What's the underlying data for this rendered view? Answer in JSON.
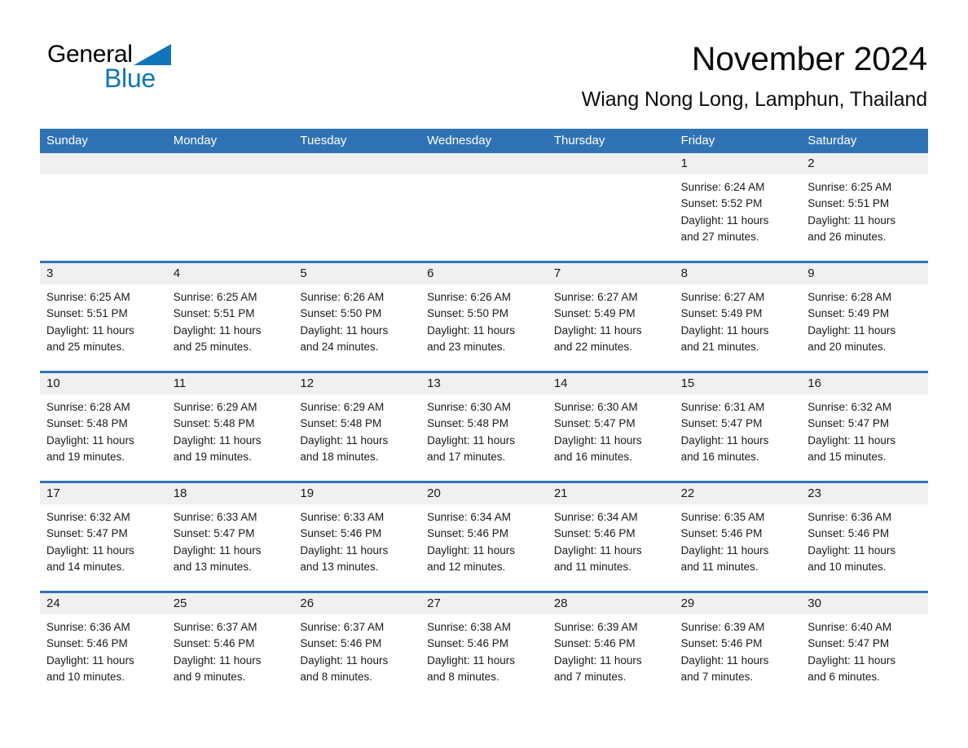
{
  "brand": {
    "name_part1": "General",
    "name_part2": "Blue",
    "triangle_icon": "blue-triangle-icon",
    "accent_color": "#1175bc"
  },
  "header": {
    "month_title": "November 2024",
    "location": "Wiang Nong Long, Lamphun, Thailand"
  },
  "calendar": {
    "header_bg_color": "#3073b4",
    "daynum_band_color": "#f0f0f0",
    "weekdays": [
      "Sunday",
      "Monday",
      "Tuesday",
      "Wednesday",
      "Thursday",
      "Friday",
      "Saturday"
    ],
    "weeks": [
      [
        {
          "day": "",
          "lines": []
        },
        {
          "day": "",
          "lines": []
        },
        {
          "day": "",
          "lines": []
        },
        {
          "day": "",
          "lines": []
        },
        {
          "day": "",
          "lines": []
        },
        {
          "day": "1",
          "lines": [
            "Sunrise: 6:24 AM",
            "Sunset: 5:52 PM",
            "Daylight: 11 hours",
            "and 27 minutes."
          ]
        },
        {
          "day": "2",
          "lines": [
            "Sunrise: 6:25 AM",
            "Sunset: 5:51 PM",
            "Daylight: 11 hours",
            "and 26 minutes."
          ]
        }
      ],
      [
        {
          "day": "3",
          "lines": [
            "Sunrise: 6:25 AM",
            "Sunset: 5:51 PM",
            "Daylight: 11 hours",
            "and 25 minutes."
          ]
        },
        {
          "day": "4",
          "lines": [
            "Sunrise: 6:25 AM",
            "Sunset: 5:51 PM",
            "Daylight: 11 hours",
            "and 25 minutes."
          ]
        },
        {
          "day": "5",
          "lines": [
            "Sunrise: 6:26 AM",
            "Sunset: 5:50 PM",
            "Daylight: 11 hours",
            "and 24 minutes."
          ]
        },
        {
          "day": "6",
          "lines": [
            "Sunrise: 6:26 AM",
            "Sunset: 5:50 PM",
            "Daylight: 11 hours",
            "and 23 minutes."
          ]
        },
        {
          "day": "7",
          "lines": [
            "Sunrise: 6:27 AM",
            "Sunset: 5:49 PM",
            "Daylight: 11 hours",
            "and 22 minutes."
          ]
        },
        {
          "day": "8",
          "lines": [
            "Sunrise: 6:27 AM",
            "Sunset: 5:49 PM",
            "Daylight: 11 hours",
            "and 21 minutes."
          ]
        },
        {
          "day": "9",
          "lines": [
            "Sunrise: 6:28 AM",
            "Sunset: 5:49 PM",
            "Daylight: 11 hours",
            "and 20 minutes."
          ]
        }
      ],
      [
        {
          "day": "10",
          "lines": [
            "Sunrise: 6:28 AM",
            "Sunset: 5:48 PM",
            "Daylight: 11 hours",
            "and 19 minutes."
          ]
        },
        {
          "day": "11",
          "lines": [
            "Sunrise: 6:29 AM",
            "Sunset: 5:48 PM",
            "Daylight: 11 hours",
            "and 19 minutes."
          ]
        },
        {
          "day": "12",
          "lines": [
            "Sunrise: 6:29 AM",
            "Sunset: 5:48 PM",
            "Daylight: 11 hours",
            "and 18 minutes."
          ]
        },
        {
          "day": "13",
          "lines": [
            "Sunrise: 6:30 AM",
            "Sunset: 5:48 PM",
            "Daylight: 11 hours",
            "and 17 minutes."
          ]
        },
        {
          "day": "14",
          "lines": [
            "Sunrise: 6:30 AM",
            "Sunset: 5:47 PM",
            "Daylight: 11 hours",
            "and 16 minutes."
          ]
        },
        {
          "day": "15",
          "lines": [
            "Sunrise: 6:31 AM",
            "Sunset: 5:47 PM",
            "Daylight: 11 hours",
            "and 16 minutes."
          ]
        },
        {
          "day": "16",
          "lines": [
            "Sunrise: 6:32 AM",
            "Sunset: 5:47 PM",
            "Daylight: 11 hours",
            "and 15 minutes."
          ]
        }
      ],
      [
        {
          "day": "17",
          "lines": [
            "Sunrise: 6:32 AM",
            "Sunset: 5:47 PM",
            "Daylight: 11 hours",
            "and 14 minutes."
          ]
        },
        {
          "day": "18",
          "lines": [
            "Sunrise: 6:33 AM",
            "Sunset: 5:47 PM",
            "Daylight: 11 hours",
            "and 13 minutes."
          ]
        },
        {
          "day": "19",
          "lines": [
            "Sunrise: 6:33 AM",
            "Sunset: 5:46 PM",
            "Daylight: 11 hours",
            "and 13 minutes."
          ]
        },
        {
          "day": "20",
          "lines": [
            "Sunrise: 6:34 AM",
            "Sunset: 5:46 PM",
            "Daylight: 11 hours",
            "and 12 minutes."
          ]
        },
        {
          "day": "21",
          "lines": [
            "Sunrise: 6:34 AM",
            "Sunset: 5:46 PM",
            "Daylight: 11 hours",
            "and 11 minutes."
          ]
        },
        {
          "day": "22",
          "lines": [
            "Sunrise: 6:35 AM",
            "Sunset: 5:46 PM",
            "Daylight: 11 hours",
            "and 11 minutes."
          ]
        },
        {
          "day": "23",
          "lines": [
            "Sunrise: 6:36 AM",
            "Sunset: 5:46 PM",
            "Daylight: 11 hours",
            "and 10 minutes."
          ]
        }
      ],
      [
        {
          "day": "24",
          "lines": [
            "Sunrise: 6:36 AM",
            "Sunset: 5:46 PM",
            "Daylight: 11 hours",
            "and 10 minutes."
          ]
        },
        {
          "day": "25",
          "lines": [
            "Sunrise: 6:37 AM",
            "Sunset: 5:46 PM",
            "Daylight: 11 hours",
            "and 9 minutes."
          ]
        },
        {
          "day": "26",
          "lines": [
            "Sunrise: 6:37 AM",
            "Sunset: 5:46 PM",
            "Daylight: 11 hours",
            "and 8 minutes."
          ]
        },
        {
          "day": "27",
          "lines": [
            "Sunrise: 6:38 AM",
            "Sunset: 5:46 PM",
            "Daylight: 11 hours",
            "and 8 minutes."
          ]
        },
        {
          "day": "28",
          "lines": [
            "Sunrise: 6:39 AM",
            "Sunset: 5:46 PM",
            "Daylight: 11 hours",
            "and 7 minutes."
          ]
        },
        {
          "day": "29",
          "lines": [
            "Sunrise: 6:39 AM",
            "Sunset: 5:46 PM",
            "Daylight: 11 hours",
            "and 7 minutes."
          ]
        },
        {
          "day": "30",
          "lines": [
            "Sunrise: 6:40 AM",
            "Sunset: 5:47 PM",
            "Daylight: 11 hours",
            "and 6 minutes."
          ]
        }
      ]
    ]
  }
}
